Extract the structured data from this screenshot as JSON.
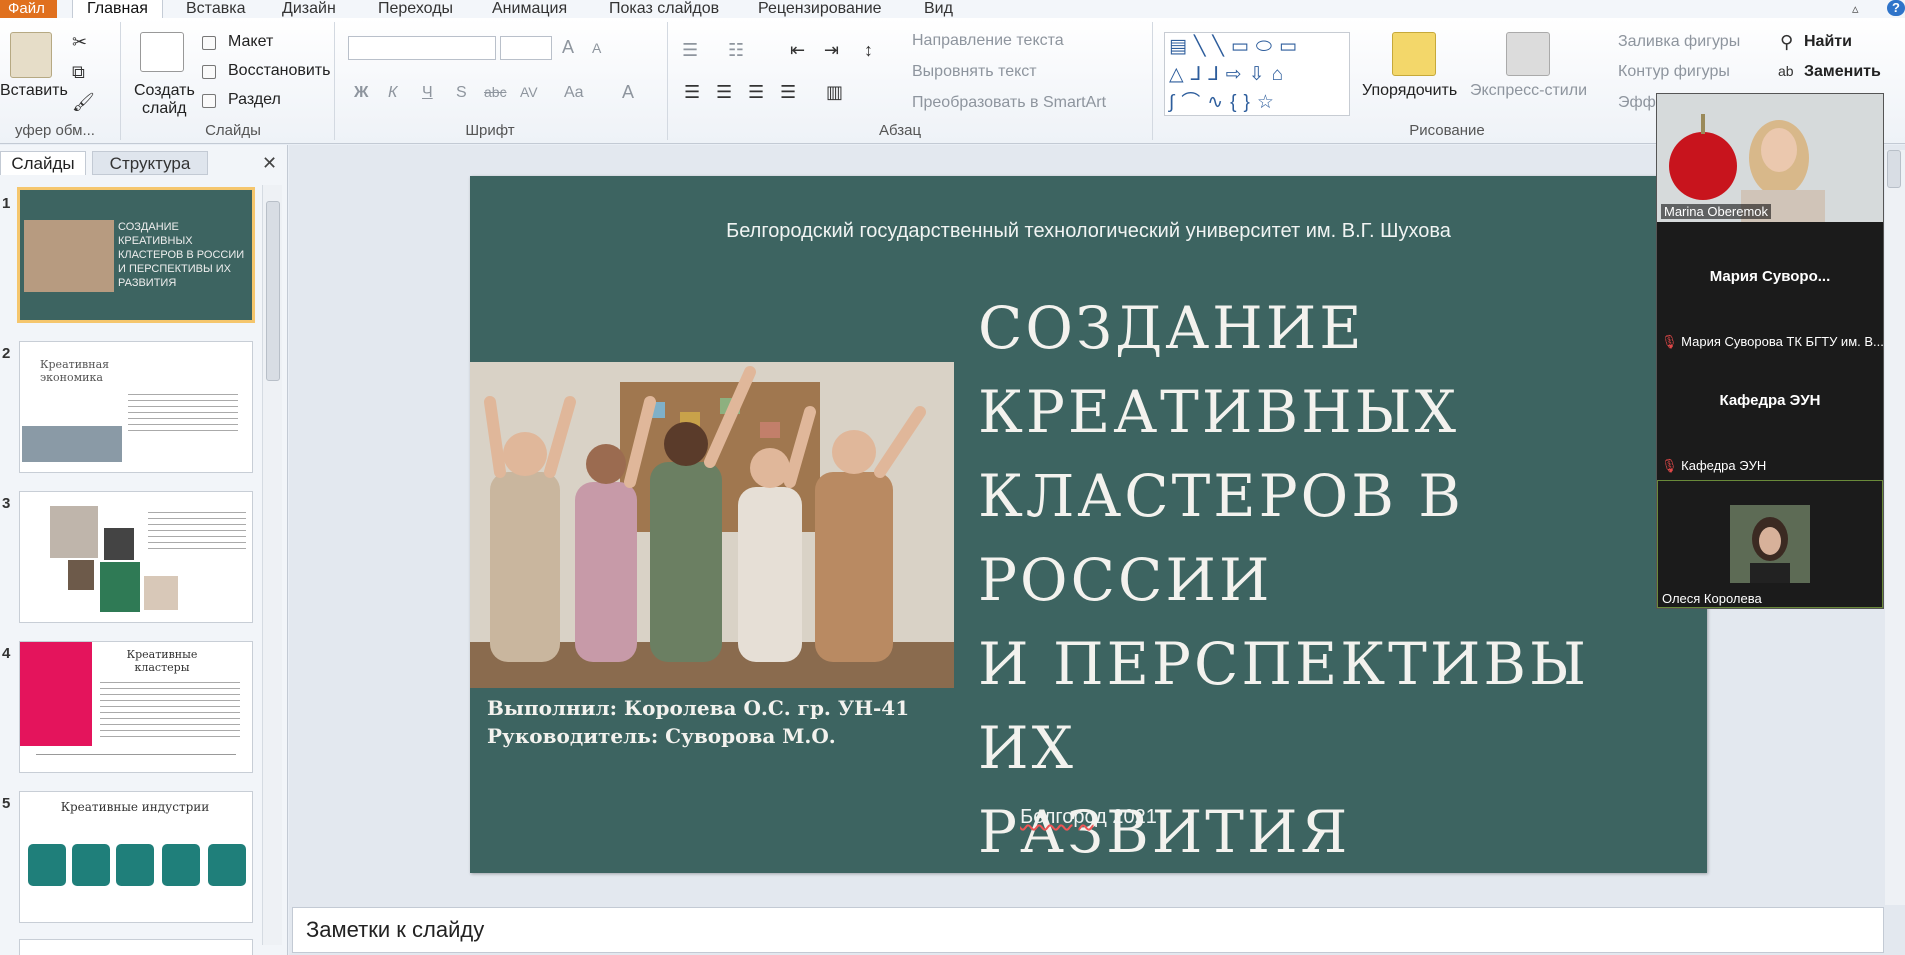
{
  "tabs": {
    "file": "Файл",
    "items": [
      "Главная",
      "Вставка",
      "Дизайн",
      "Переходы",
      "Анимация",
      "Показ слайдов",
      "Рецензирование",
      "Вид"
    ]
  },
  "ribbon": {
    "clipboard": {
      "paste": "Вставить",
      "label": "уфер обм..."
    },
    "slides": {
      "create_line1": "Создать",
      "create_line2": "слайд",
      "layout": "Макет",
      "restore": "Восстановить",
      "section": "Раздел",
      "label": "Слайды"
    },
    "font": {
      "label": "Шрифт",
      "bold": "Ж",
      "italic": "К",
      "underline": "Ч",
      "shadow": "S",
      "strike": "abc",
      "spacing": "AV",
      "case": "Aa",
      "color": "A",
      "grow": "A",
      "shrink": "A"
    },
    "paragraph": {
      "label": "Абзац",
      "direction": "Направление текста",
      "align": "Выровнять текст",
      "smartart": "Преобразовать в SmartArt"
    },
    "drawing": {
      "label": "Рисование",
      "arrange": "Упорядочить",
      "styles": "Экспресс-стили",
      "fill": "Заливка фигуры",
      "outline": "Контур фигуры",
      "effects": "Эфф"
    },
    "editing": {
      "find": "Найти",
      "replace": "Заменить"
    }
  },
  "left_panel": {
    "tab_slides": "Слайды",
    "tab_outline": "Структура",
    "close": "✕",
    "slides": [
      {
        "num": "1",
        "title": "СОЗДАНИЕ КРЕАТИВНЫХ КЛАСТЕРОВ В РОССИИ И ПЕРСПЕКТИВЫ ИХ РАЗВИТИЯ"
      },
      {
        "num": "2",
        "title": "Креативная экономика"
      },
      {
        "num": "3",
        "title": ""
      },
      {
        "num": "4",
        "title": "Креативные кластеры"
      },
      {
        "num": "5",
        "title": "Креативные индустрии"
      }
    ]
  },
  "slide": {
    "university": "Белгородский государственный технологический университет им. В.Г. Шухова",
    "title_lines": [
      "СОЗДАНИЕ",
      "КРЕАТИВНЫХ",
      "КЛАСТЕРОВ В РОССИИ",
      "И ПЕРСПЕКТИВЫ ИХ",
      "РАЗВИТИЯ"
    ],
    "author": "Выполнил: Королева О.С. гр. УН-41",
    "supervisor": "Руководитель: Суворова М.О.",
    "city": "Белгород",
    "year": "2021"
  },
  "notes": {
    "placeholder": "Заметки к слайду"
  },
  "video": {
    "participants": [
      {
        "name": "Marina Oberemok"
      },
      {
        "display": "Мария Суворо...",
        "name": "Мария Суворова ТК БГТУ им. В..."
      },
      {
        "display": "Кафедра ЭУН",
        "name": "Кафедра ЭУН"
      },
      {
        "name": "Олеся Королева"
      }
    ]
  },
  "colors": {
    "slide_bg": "#3d6461",
    "file_tab": "#e0701e",
    "selected_thumb": "#f5c66d"
  }
}
